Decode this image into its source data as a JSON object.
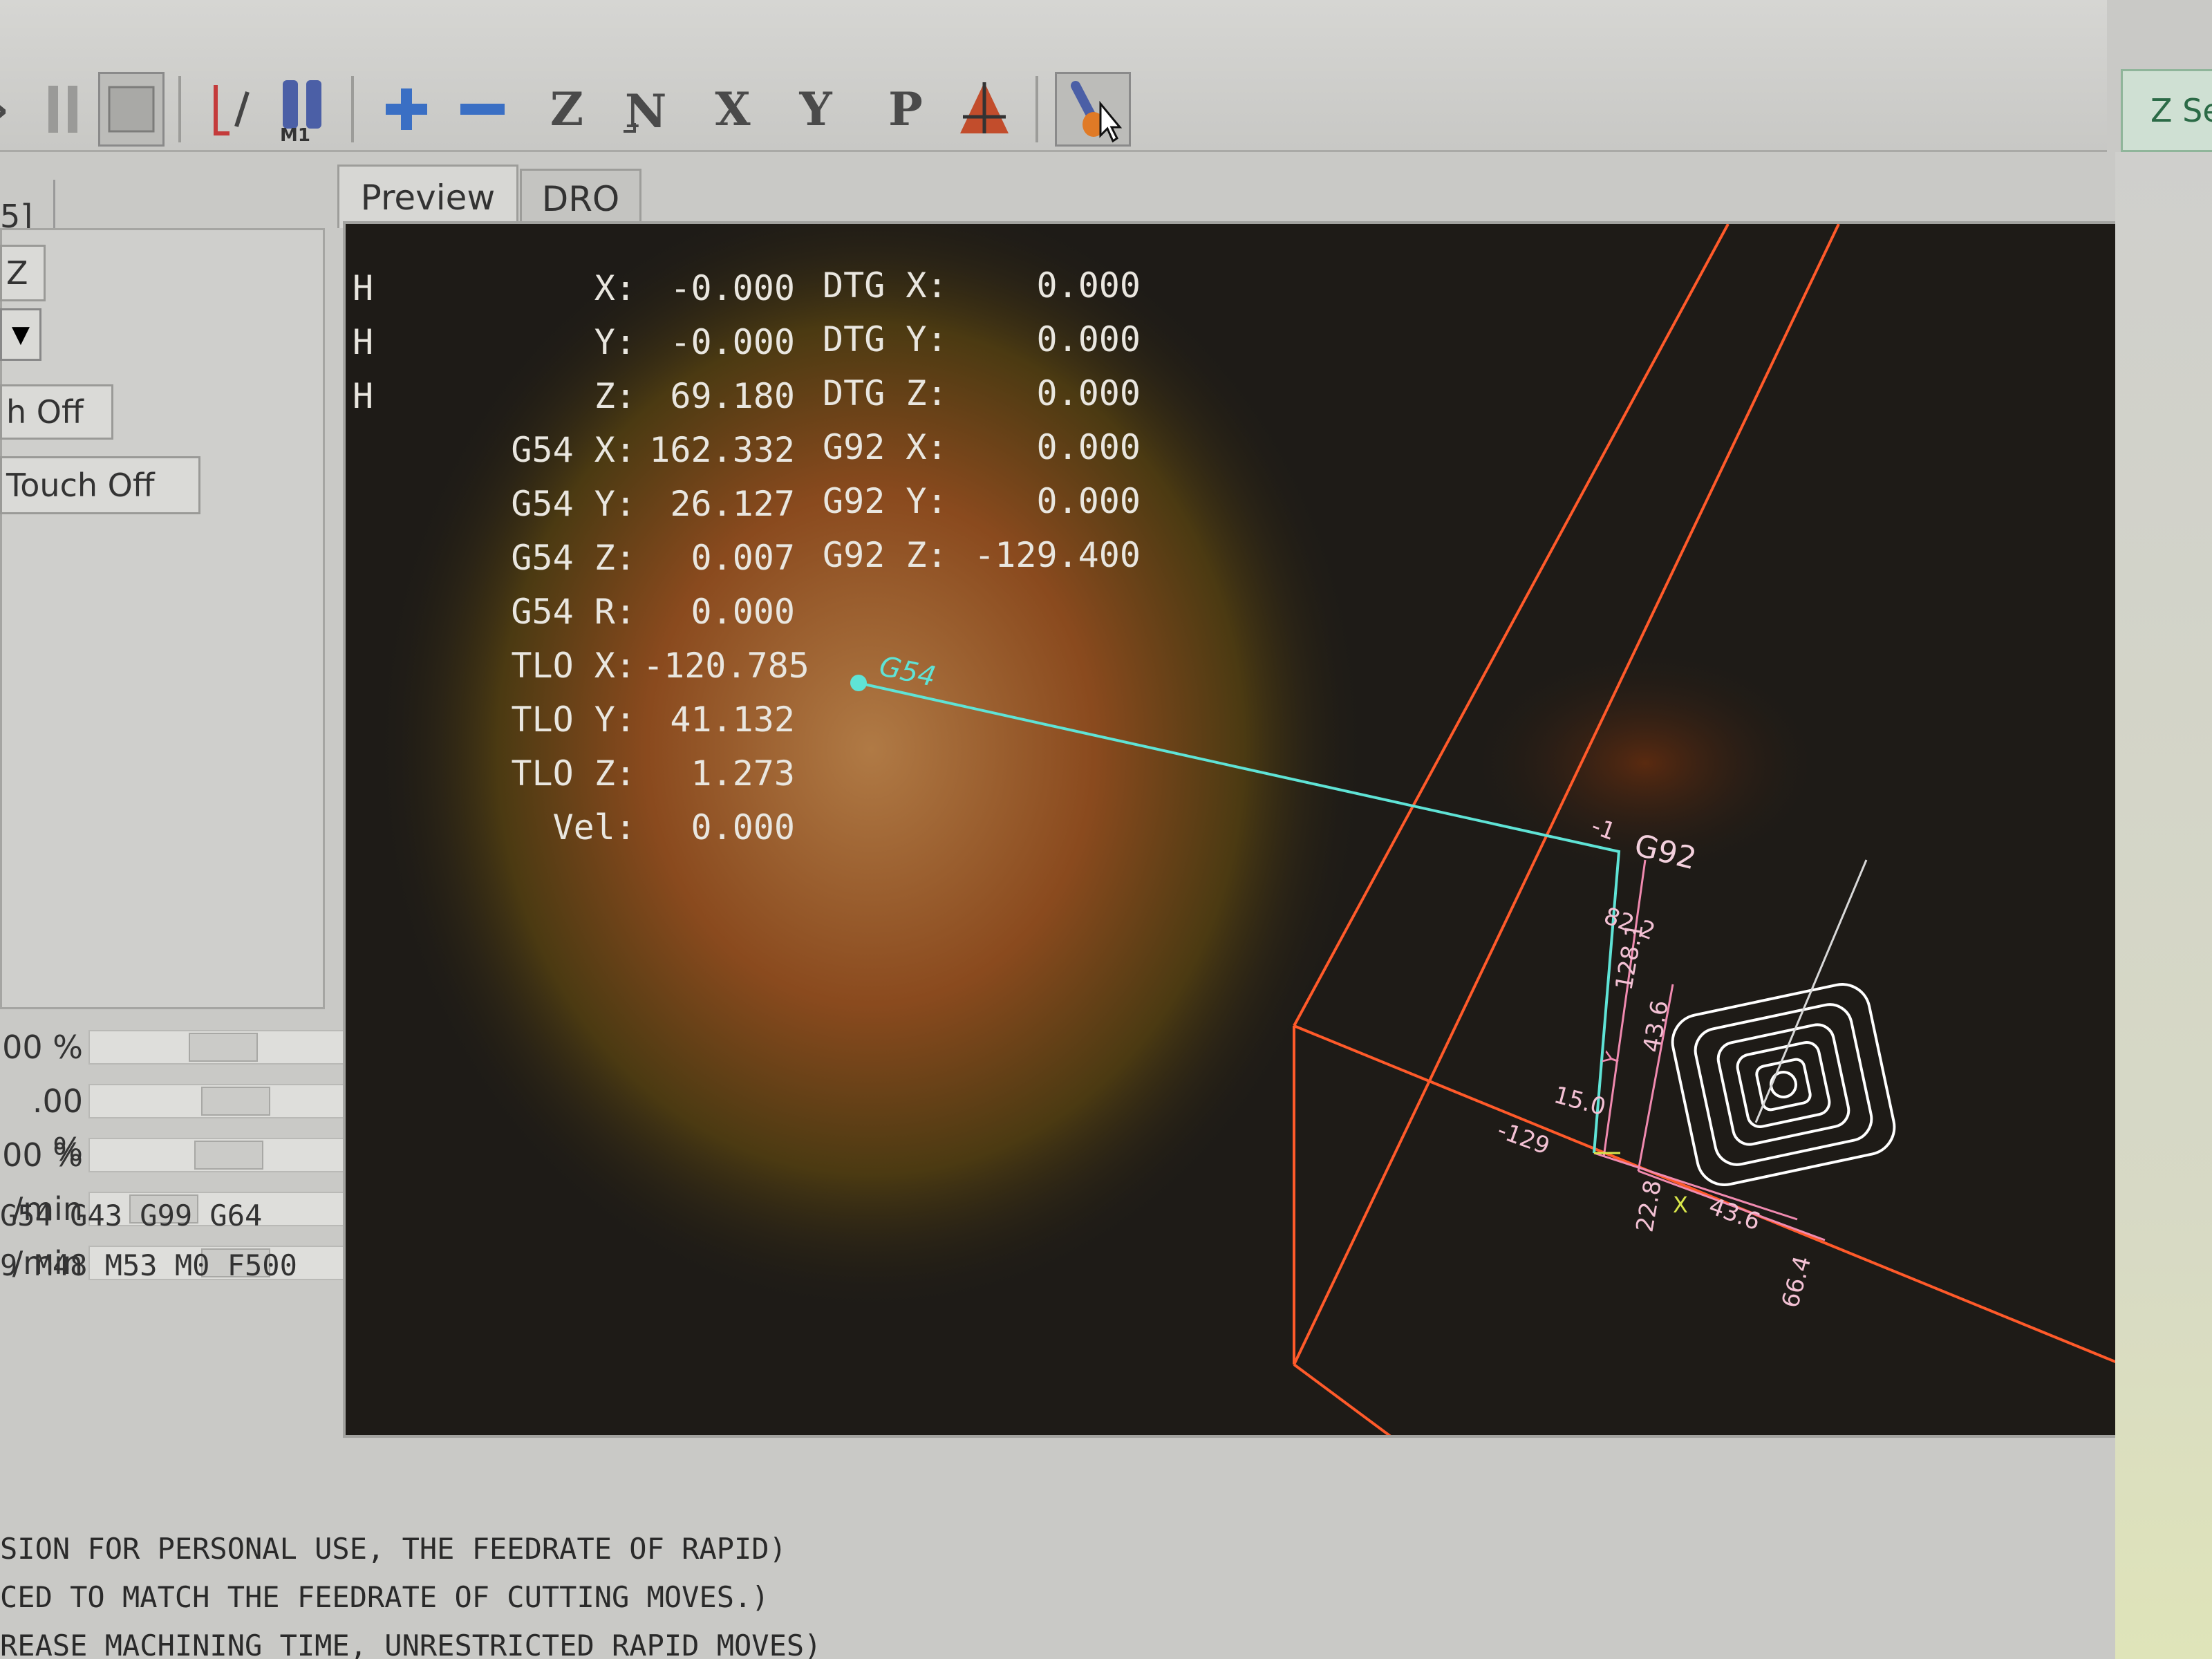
{
  "toolbar": {
    "zset_label": "Z Se",
    "axis_buttons": [
      "Z",
      "X",
      "Y",
      "P"
    ],
    "m1_label": "M1"
  },
  "left_panel": {
    "tab_label": "5]",
    "axis_value": "Z",
    "touch_off_label": "h Off",
    "touch_off_2_label": "Touch Off",
    "overrides": [
      {
        "label": "00 %",
        "knob_frac": 0.55
      },
      {
        "label": ".00 %",
        "knob_frac": 0.62
      },
      {
        "label": "00 %",
        "knob_frac": 0.58
      },
      {
        "label": "/min",
        "knob_frac": 0.22
      },
      {
        "label": "/min",
        "knob_frac": 0.62
      }
    ],
    "modal_line_1": "G54 G43 G99 G64",
    "modal_line_2": "9 M48 M53 M0 F500"
  },
  "tabs": [
    "Preview",
    "DRO"
  ],
  "dro": {
    "col1": [
      {
        "prefix": "H",
        "label": "X:",
        "value": "-0.000"
      },
      {
        "prefix": "H",
        "label": "Y:",
        "value": "-0.000"
      },
      {
        "prefix": "H",
        "label": "Z:",
        "value": "69.180"
      },
      {
        "prefix": "",
        "label": "G54 X:",
        "value": "162.332"
      },
      {
        "prefix": "",
        "label": "G54 Y:",
        "value": "26.127"
      },
      {
        "prefix": "",
        "label": "G54 Z:",
        "value": "0.007"
      },
      {
        "prefix": "",
        "label": "G54 R:",
        "value": "0.000"
      },
      {
        "prefix": "",
        "label": "TLO X:",
        "value": "-120.785"
      },
      {
        "prefix": "",
        "label": "TLO Y:",
        "value": "41.132"
      },
      {
        "prefix": "",
        "label": "TLO Z:",
        "value": "1.273"
      },
      {
        "prefix": "",
        "label": "Vel:",
        "value": "0.000"
      }
    ],
    "col2": [
      {
        "label": "DTG X:",
        "value": "0.000"
      },
      {
        "label": "DTG Y:",
        "value": "0.000"
      },
      {
        "label": "DTG Z:",
        "value": "0.000"
      },
      {
        "label": "G92 X:",
        "value": "0.000"
      },
      {
        "label": "G92 Y:",
        "value": "0.000"
      },
      {
        "label": "G92 Z:",
        "value": "-129.400"
      }
    ]
  },
  "preview_labels": {
    "g54": "G54",
    "g92": "G92",
    "dim_1": "128.1",
    "dim_2": "43.6",
    "dim_3": "82.2",
    "dim_4": "22.8",
    "dim_5": "43.6",
    "dim_6": "66.4",
    "dim_7": "15.0",
    "dim_8": "-129",
    "dim_9": "-1",
    "axis_x": "X",
    "axis_y": "Y"
  },
  "gcode_lines": [
    "SION FOR PERSONAL USE, THE FEEDRATE OF RAPID)",
    "CED TO MATCH THE FEEDRATE OF CUTTING MOVES.)",
    "REASE MACHINING TIME, UNRESTRICTED RAPID MOVES)"
  ],
  "colors": {
    "preview_bg": "#1e1b17",
    "extent_lines": "#ff5a2a",
    "path": "#5fe3d6",
    "dims": "#f08ab0",
    "toolpath": "#ffffff"
  }
}
